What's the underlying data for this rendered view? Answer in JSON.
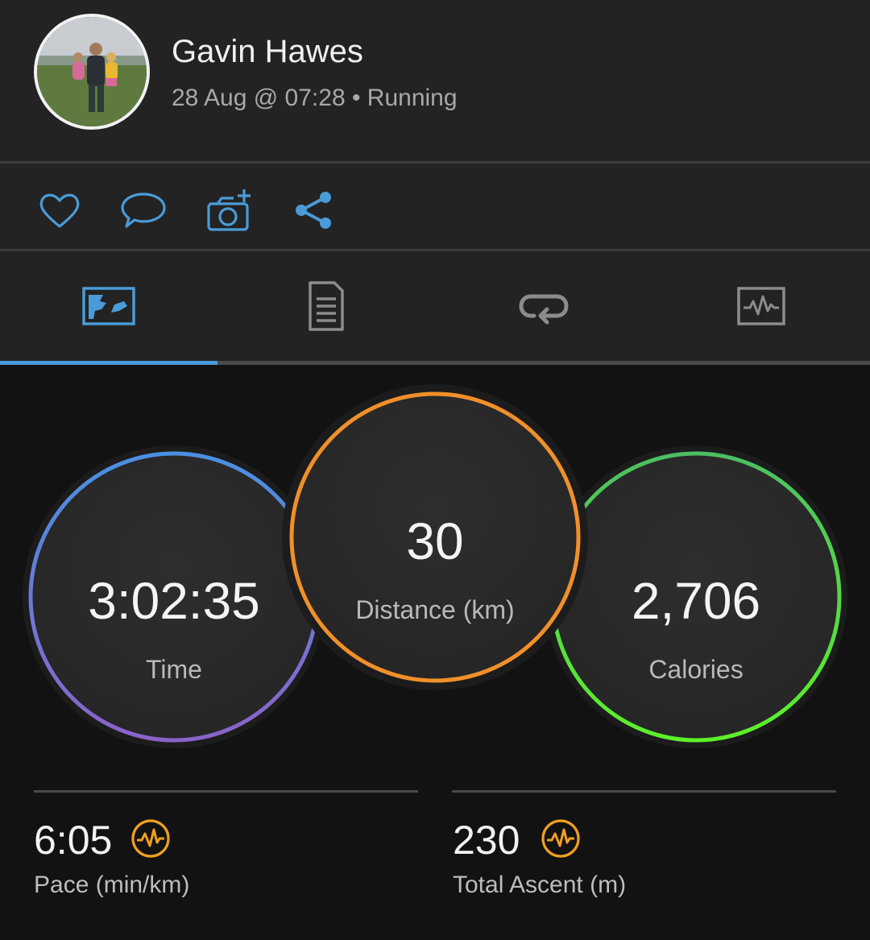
{
  "profile": {
    "name": "Gavin Hawes",
    "meta": "28 Aug @ 07:28 • Running"
  },
  "actions": [
    {
      "icon": "heart-icon"
    },
    {
      "icon": "comment-icon"
    },
    {
      "icon": "add-photo-icon"
    },
    {
      "icon": "share-icon"
    }
  ],
  "tabs": [
    {
      "icon": "map-overview-icon",
      "active": true
    },
    {
      "icon": "details-list-icon",
      "active": false
    },
    {
      "icon": "laps-icon",
      "active": false
    },
    {
      "icon": "chart-icon",
      "active": false
    }
  ],
  "stats": {
    "time": {
      "value": "3:02:35",
      "label": "Time"
    },
    "distance": {
      "value": "30",
      "label": "Distance (km)"
    },
    "calories": {
      "value": "2,706",
      "label": "Calories"
    }
  },
  "metrics": {
    "pace": {
      "value": "6:05",
      "label": "Pace (min/km)",
      "icon": "performance-icon"
    },
    "ascent": {
      "value": "230",
      "label": "Total Ascent (m)",
      "icon": "performance-icon"
    }
  },
  "colors": {
    "accent": "#4a9bd8",
    "time_ring_start": "#4a90e2",
    "time_ring_end": "#8a63c9",
    "distance_ring": "#f0902a",
    "calories_ring_start": "#4cbf62",
    "calories_ring_end": "#5cf02a",
    "metric_icon": "#f0a020"
  }
}
